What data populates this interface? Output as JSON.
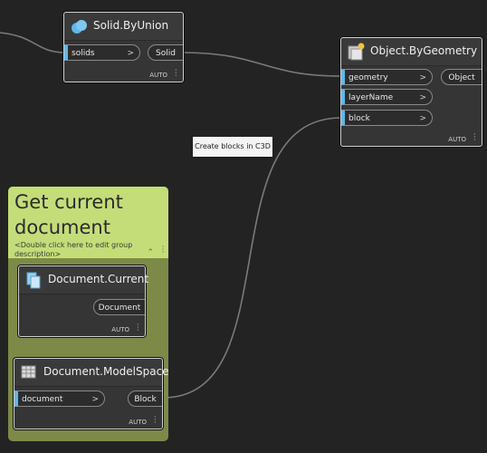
{
  "nodes": {
    "union": {
      "title": "Solid.ByUnion",
      "icon": "solid-union-icon",
      "inputs": [
        {
          "label": "solids",
          "chevron": ">"
        }
      ],
      "output": "Solid",
      "lacing": "AUTO"
    },
    "geometry": {
      "title": "Object.ByGeometry",
      "icon": "object-by-geometry-icon",
      "inputs": [
        {
          "label": "geometry",
          "chevron": ">"
        },
        {
          "label": "layerName",
          "chevron": ">"
        },
        {
          "label": "block",
          "chevron": ">"
        }
      ],
      "output": "Object",
      "lacing": "AUTO"
    },
    "current": {
      "title": "Document.Current",
      "icon": "document-icon",
      "output": "Document",
      "lacing": "AUTO"
    },
    "modelspace": {
      "title": "Document.ModelSpace",
      "icon": "table-grid-icon",
      "inputs": [
        {
          "label": "document",
          "chevron": ">"
        }
      ],
      "output": "Block",
      "lacing": "AUTO"
    }
  },
  "group": {
    "title": "Get current document",
    "description": "<Double click here to edit group description>",
    "collapse_glyph": "^",
    "color": "#c4dd79"
  },
  "tooltip": "Create blocks in C3D",
  "colors": {
    "background": "#232323",
    "port_accent": "#66b5e6",
    "group_body": "#7d8a47"
  }
}
